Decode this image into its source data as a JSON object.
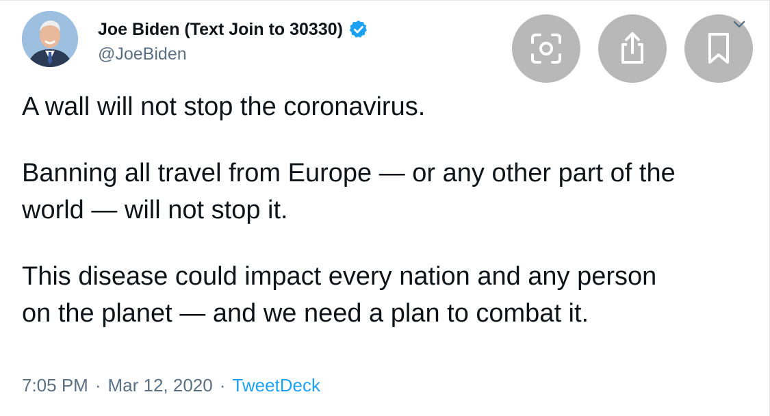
{
  "tweet": {
    "author": {
      "display_name": "Joe Biden (Text Join to 30330)",
      "handle": "@JoeBiden",
      "verified": true,
      "avatar_icon": "profile-photo"
    },
    "paragraphs": [
      [
        "A wall will not stop the coronavirus."
      ],
      [
        "Banning all travel from Europe — or any other part of the",
        "world — will not stop it."
      ],
      [
        "This disease could impact every nation and any person",
        "on the planet — and we need a plan to combat it."
      ]
    ],
    "meta": {
      "time": "7:05 PM",
      "separator": "·",
      "date": "Mar 12, 2020",
      "source": "TweetDeck"
    }
  },
  "overlay_actions": [
    {
      "icon": "visual-search-icon"
    },
    {
      "icon": "share-icon"
    },
    {
      "icon": "bookmark-icon"
    },
    {
      "icon": "chevron-down-icon"
    }
  ],
  "colors": {
    "verified_badge": "#1da1f2",
    "link": "#1da1f2",
    "secondary_text": "#5b7083",
    "action_button_bg": "#b8b8b8"
  }
}
